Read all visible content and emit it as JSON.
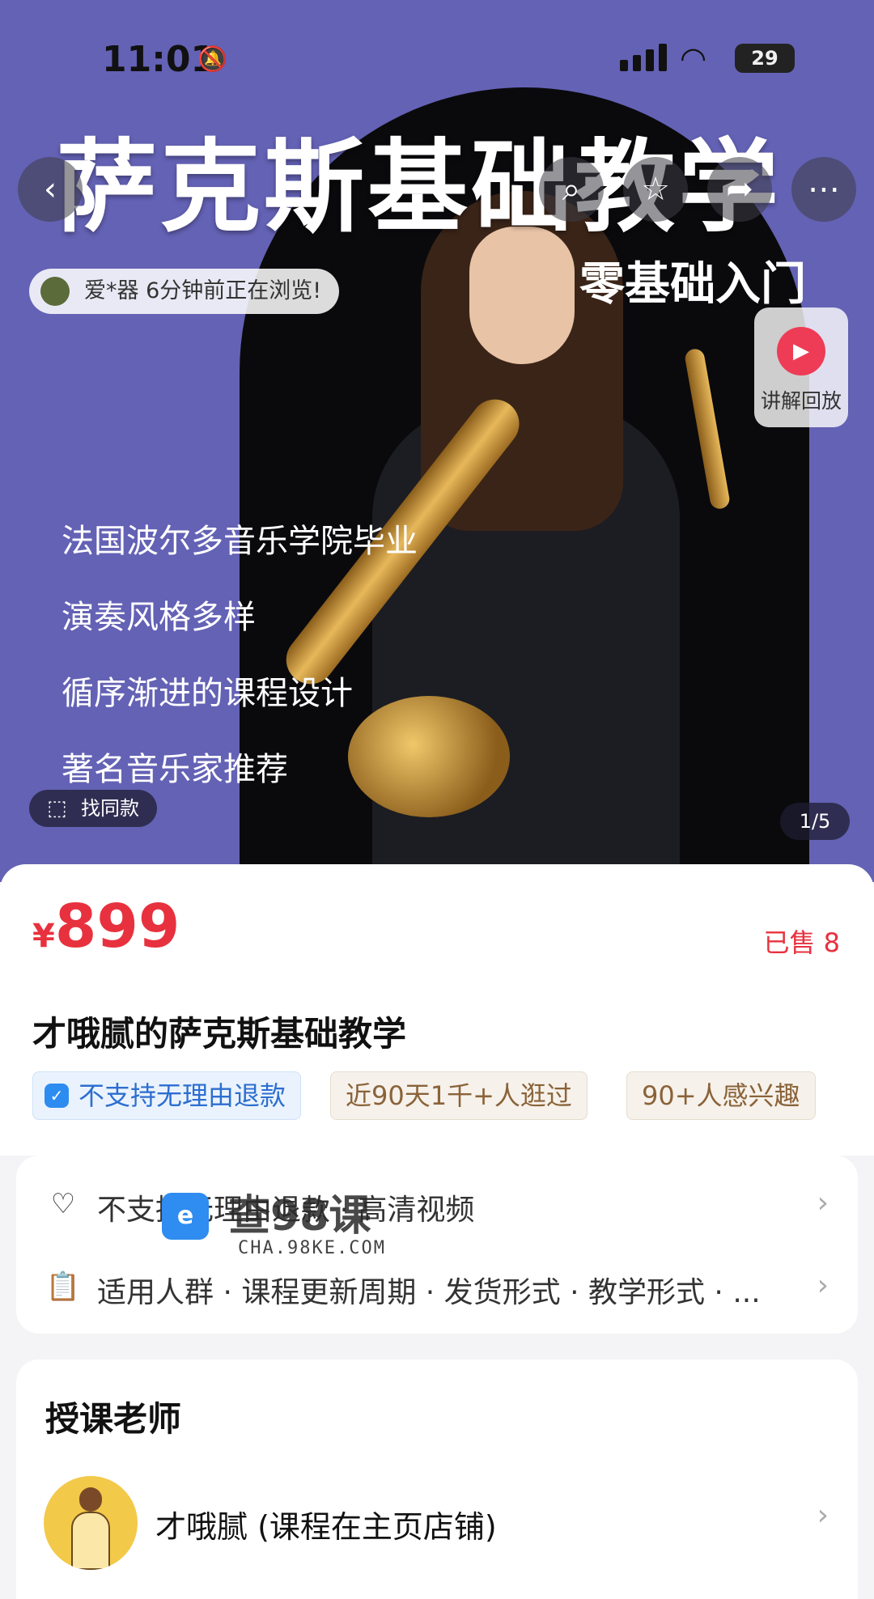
{
  "status_bar": {
    "time": "11:01",
    "battery": "29",
    "bell_icon": "bell-muted-icon",
    "wifi_icon": "wifi-icon",
    "signal_icon": "signal-icon"
  },
  "hero": {
    "title": "萨克斯基础教学",
    "subtitle": "零基础入门",
    "features": [
      "法国波尔多音乐学院毕业",
      "演奏风格多样",
      "循序渐进的课程设计",
      "著名音乐家推荐"
    ],
    "browsing_text": "爱*器 6分钟前正在浏览!",
    "replay_label": "讲解回放",
    "same_style_label": "找同款",
    "page_indicator": "1/5",
    "colors": {
      "background": "#6462b5",
      "arch": "#0a0a0d"
    }
  },
  "nav": {
    "back_icon": "chevron-left-icon",
    "search_icon": "search-icon",
    "favorite_icon": "star-icon",
    "share_icon": "share-icon",
    "more_icon": "more-icon"
  },
  "product": {
    "currency": "¥",
    "price": "899",
    "sold": "已售 8",
    "title": "才哦腻的萨克斯基础教学",
    "tags": [
      "不支持无理由退款",
      "近90天1千+人逛过",
      "90+人感兴趣"
    ],
    "accent_color": "#e8313e"
  },
  "services": {
    "row1": "不支持无理由退款 · 高清视频",
    "row2": "适用人群 · 课程更新周期 · 发货形式 · 教学形式 · ..."
  },
  "watermark": {
    "logo": "e",
    "main": "查98课",
    "url": "CHA.98KE.COM"
  },
  "teacher": {
    "heading": "授课老师",
    "name": "才哦腻 (课程在主页店铺)"
  }
}
